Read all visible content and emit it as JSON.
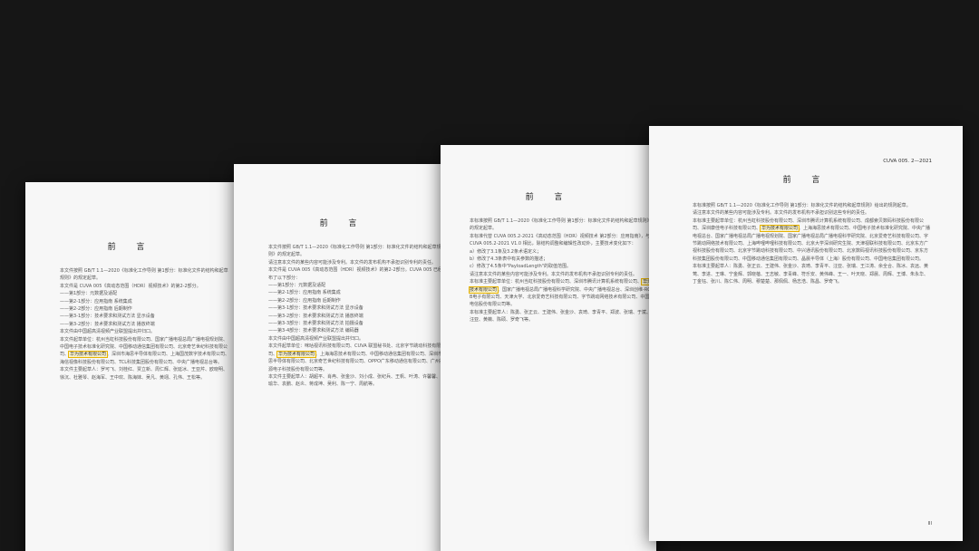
{
  "pages": {
    "p1": {
      "title": "前 言",
      "lines": [
        "本文件按照 GB/T 1.1—2020《标准化工作导则 第1部分：标准化文件的结构和起草规则》的规定起草。",
        "本文件是 CUVA 005《高动态范围（HDR）视频技术》的第2-2部分。",
        "——第1部分：元数据及适配",
        "——第2-1部分：应用指南 系统集成",
        "——第2-2部分：应用指南 后期制作",
        "——第3-1部分：技术要求和测试方法 显示设备",
        "——第3-2部分：技术要求和测试方法 播放终端",
        "本文件由中国超高清视频产业联盟提出并归口。"
      ],
      "drafting_pre": "本文件起草单位：杭州当虹科技股份有限公司、国家广播电视总局广播电视规划院、中国电子技术标准化研究院、中国移动通信集团有限公司、北京奇艺世纪科技有限公司、",
      "highlight": "华为技术有限公司",
      "drafting_post": "、深圳市海思半导体有限公司、上海国茂数字技术有限公司、海信视像科技股份有限公司、TCL科技集团股份有限公司、中央广播电视总台等。",
      "drafters": "本文件主要起草人：罗可飞、刘桂红、贾立新、周仁辉、张延冰、王亚芹、欧晓明、徐沉、杜雅琴、赵海军、王中欢、陈海妹、吴凡、黄翊、孔伟、王松等。"
    },
    "p2": {
      "title": "前 言",
      "lines": [
        "本文件按照 GB/T 1.1—2020《标准化工作导则 第1部分：标准化文件的结构和起草规则》的规定起草。",
        "请注意本文件的某些内容可能涉及专利。本文件的发布机构不承担识别专利的责任。",
        "本文件是 CUVA 005《高动态范围（HDR）视频技术》的第2-2部分。CUVA 005 已经发布了以下部分：",
        "——第1部分：元数据及适配",
        "——第2-1部分：应用指南 系统集成",
        "——第2-2部分：应用指南 后期制作",
        "——第3-1部分：技术要求和测试方法 显示设备",
        "——第3-2部分：技术要求和测试方法 播放终端",
        "——第3-3部分：技术要求和测试方法 拍摄设备",
        "——第3-4部分：技术要求和测试方法 编码器",
        "本文件由中国超高清视频产业联盟提出并归口。"
      ],
      "drafting_pre": "本文件起草单位：咪咕视讯科技有限公司、CUVA 联盟秘书处、北京字节跳动科技有限公司、",
      "highlight": "华为技术有限公司",
      "drafting_post": "、上海海思技术有限公司、中国移动通信集团有限公司、深圳市海思半导体有限公司、北京奇艺世纪科技有限公司、OPPO广东移动通信有限公司、广州视源电子科技股份有限公司等。",
      "drafters": "本文件主要起草人：胡超平、肖冉、张金沙、刘小成、张纪兵、王帆、叶涛、许馨馨、许瑜华、袁鹏、赵炎、蒋成坤、吴利、陈一宁、周航等。"
    },
    "p3": {
      "title": "前 言",
      "lines": [
        "本标准按照 GB/T 1.1—2020《标准化工作导则 第1部分：标准化文件的结构和起草规则》的规定起草。",
        "本标准代替 CUVA 005.2-2021《高动态范围（HDR）视频技术 第2部分：应用指南》，与 CUVA 005.2-2021 V1.0 相比，除结构调整和编辑性改动外，主要技术变化如下：",
        "a）修改了3.1条及3.2条术语定义；",
        "b）修改了4.3条表中有关参数的描述；",
        "c）修改了4.5条中\"PayloadLength\"的取值范围。",
        "请注意本文件的某些内容可能涉及专利。本文件的发布机构不承担识别专利的责任。"
      ],
      "drafting_pre": "本标准主要起草单位：杭州当虹科技股份有限公司、深圳市腾讯计算机系统有限公司、",
      "highlight": "华为技术有限公司",
      "drafting_post": "、国家广播电视总局广播电视科学研究院、中央广播电视总台、深圳创维-RGB电子有限公司、天津大学、北京爱奇艺科技有限公司、字节跳动网络技术有限公司、中国电信股份有限公司等。",
      "drafters": "本标准主要起草人：陈勇、张正云、王建伟、张金沙、袁琦、李青平、郑波、张瑞、于斌、汪亚、黄薇、陈硕、罗奇飞等。"
    },
    "p4": {
      "header_code": "CUVA 005. 2—2021",
      "title": "前 言",
      "lines": [
        "本标准按照 GB/T 1.1—2020《标准化工作导则 第1部分：标准化文件的结构和起草规则》给出的规则起草。",
        "请注意本文件的某些内容可能涉及专利。本文件的发布机构不承担识别这些专利的责任。"
      ],
      "drafting_pre": "本标准主要起草单位：杭州当虹科技股份有限公司、深圳市腾讯计算机系统有限公司、成都索贝数码科技股份有限公司、深圳康佳电子科技有限公司、",
      "highlight": "华为技术有限公司",
      "drafting_post": "、上海海思技术有限公司、中国电子技术标准化研究院、中央广播电视总台、国家广播电视总局广播电视规划院、国家广播电视总局广播电视科学研究院、北京爱奇艺科技有限公司、字节跳动网络技术有限公司、上海哔哩哔哩科技有限公司、北京大学深圳研究生院、天津视联科技有限公司、北京东方广视科技股份有限公司、北京字节跳动科技有限公司、中兴通讯股份有限公司、北京数码视讯科技股份有限公司、京东方科技集团股份有限公司、中国移动通信集团有限公司、晶晨半导体（上海）股份有限公司、中国电信集团有限公司。",
      "drafters": "本标准主要起草人：陈勇、张正云、王建伟、张金沙、袁琦、李青平、汪亚、张瑞、王江涛、余全合、陈冰、袁远、黄莺、李进、王琳、宁金辉、郭晓蓓、王志敏、李青峰、符乐安、黄伟峰、王一、叶天晓、郑晨、周辉、王博、朱永华、丁金钰、张川、陈仁伟、周明、穆楚楚、那佩佩、杨志浩、陈昌、罗奇飞。",
      "page_number": "III"
    }
  },
  "colors": {
    "background": "#161616",
    "paper": "#f7f7f7",
    "highlight_border": "#e8b400"
  }
}
